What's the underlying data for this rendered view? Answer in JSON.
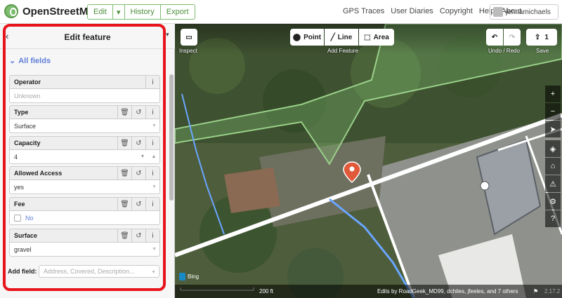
{
  "header": {
    "app_name": "OpenStreetMap",
    "edit_label": "Edit",
    "history_label": "History",
    "export_label": "Export",
    "nav": [
      "GPS Traces",
      "User Diaries",
      "Copyright",
      "Help",
      "About"
    ],
    "username": "jennamichaels"
  },
  "panel": {
    "title": "Edit feature",
    "all_fields_label": "All fields",
    "fields": [
      {
        "label": "Operator",
        "value": "Unknown",
        "is_placeholder": true
      },
      {
        "label": "Type",
        "value": "Surface"
      },
      {
        "label": "Capacity",
        "value": "4"
      },
      {
        "label": "Allowed Access",
        "value": "yes"
      },
      {
        "label": "Fee",
        "value": "No"
      },
      {
        "label": "Surface",
        "value": "gravel"
      }
    ],
    "add_field_label": "Add field:",
    "add_field_placeholder": "Address, Covered, Description..."
  },
  "map": {
    "inspect_label": "Inspect",
    "add_point": "Point",
    "add_line": "Line",
    "add_area": "Area",
    "add_feature_label": "Add Feature",
    "undo_redo_label": "Undo / Redo",
    "save_count": "1",
    "save_label": "Save",
    "imagery_label": "Bing",
    "scale_label": "200 ft",
    "attribution": "Edits by RoadGeek_MD99, dchiles, jfeeles, and 7 others",
    "version": "2.17.2"
  },
  "colors": {
    "accent_green": "#7ebc6f",
    "highlight_red": "#e8141c",
    "link_blue": "#5f7fd9"
  }
}
